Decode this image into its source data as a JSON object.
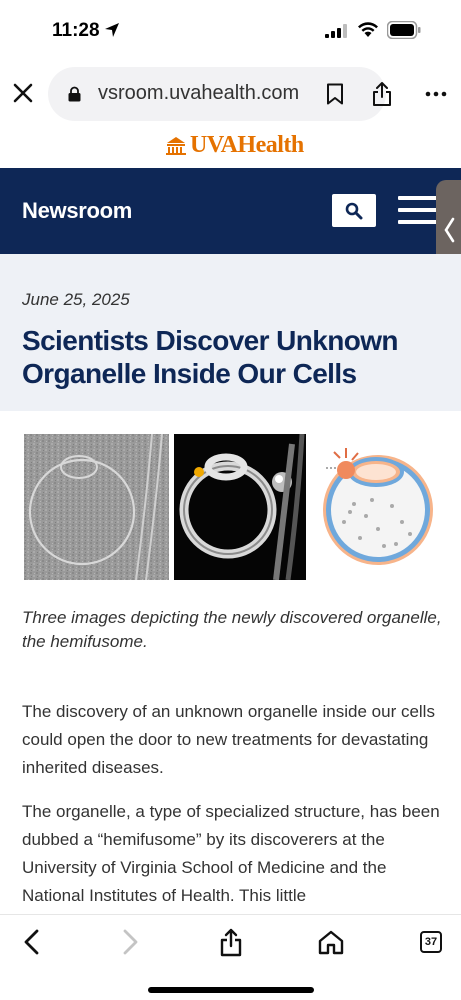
{
  "status_bar": {
    "time": "11:28"
  },
  "browser": {
    "url": "vsroom.uvahealth.com",
    "tab_count": "37"
  },
  "logo": {
    "text": "UVAHealth",
    "color": "#e57200"
  },
  "header": {
    "title": "Newsroom",
    "bg_color": "#0e2756"
  },
  "article": {
    "date": "June 25, 2025",
    "title": "Scientists Discover Unknown Organelle Inside Our Cells",
    "caption": "Three images depicting the newly discovered organelle, the hemifusome.",
    "paragraphs": [
      "The discovery of an unknown organelle inside our cells could open the door to new treatments for devastating inherited diseases.",
      "The organelle, a type of specialized structure, has been dubbed a “hemifusome” by its discoverers at the University of Virginia School of Medicine and the National Institutes of Health. This little"
    ]
  }
}
